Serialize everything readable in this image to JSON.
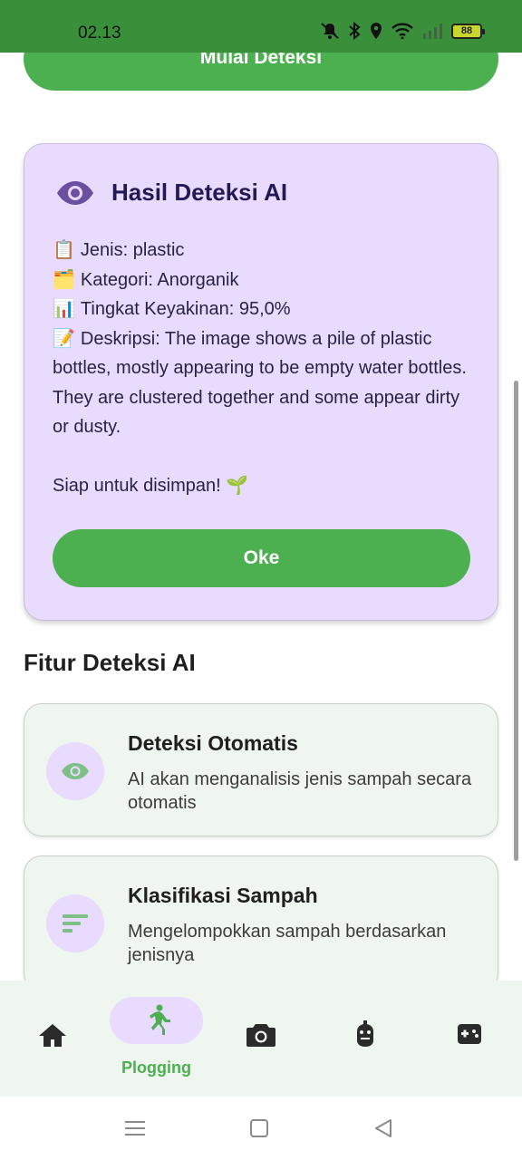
{
  "status_bar": {
    "time": "02.13",
    "battery_level": "88",
    "icons": [
      "mute-icon",
      "bluetooth-icon",
      "location-icon",
      "wifi-icon",
      "signal-icon",
      "battery-icon"
    ]
  },
  "top_button": {
    "label": "Mulai Deteksi"
  },
  "result_card": {
    "title": "Hasil Deteksi AI",
    "icon": "eye-icon",
    "type_line": "Jenis: plastic",
    "category_line": "Kategori: Anorganik",
    "confidence_line": "Tingkat Keyakinan: 95,0%",
    "description_line": "Deskripsi: The image shows a pile of plastic bottles, mostly appearing to be empty water bottles.  They are clustered together and some appear dirty or dusty.",
    "ready_line": "Siap untuk disimpan! 🌱",
    "ok_label": "Oke"
  },
  "features_section": {
    "title": "Fitur Deteksi AI",
    "items": [
      {
        "title": "Deteksi Otomatis",
        "description": "AI akan menganalisis jenis sampah secara otomatis",
        "icon": "eye-icon"
      },
      {
        "title": "Klasifikasi Sampah",
        "description": "Mengelompokkan sampah berdasarkan jenisnya",
        "icon": "sort-icon"
      }
    ]
  },
  "bottom_nav": {
    "items": [
      {
        "icon": "home-icon",
        "label": ""
      },
      {
        "icon": "running-icon",
        "label": "Plogging",
        "active": true
      },
      {
        "icon": "camera-icon",
        "label": ""
      },
      {
        "icon": "robot-icon",
        "label": ""
      },
      {
        "icon": "gamepad-icon",
        "label": ""
      }
    ]
  },
  "colors": {
    "primary_green": "#4caf50",
    "status_bar_green": "#3a8f3b",
    "lavender": "#e8dbfd",
    "card_background": "#eff5ef"
  }
}
